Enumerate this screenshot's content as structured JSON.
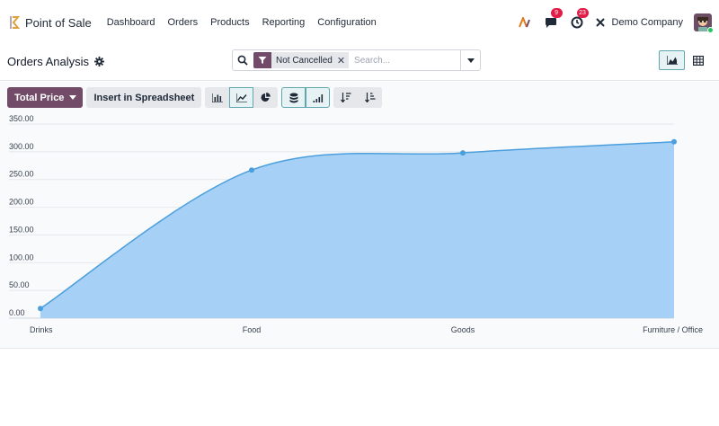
{
  "navbar": {
    "app_name": "Point of Sale",
    "menu": [
      "Dashboard",
      "Orders",
      "Products",
      "Reporting",
      "Configuration"
    ],
    "messages_count": "9",
    "activities_count": "23",
    "company_name": "Demo Company"
  },
  "control_panel": {
    "title": "Orders Analysis",
    "facet_label": "Not Cancelled",
    "search_placeholder": "Search..."
  },
  "toolbar": {
    "measure_label": "Total Price",
    "insert_label": "Insert in Spreadsheet"
  },
  "colors": {
    "brand": "#714b67",
    "accent": "#5fa6ad",
    "area_fill": "#a6d0f5",
    "line": "#4a9fdc"
  },
  "chart_data": {
    "type": "area",
    "categories": [
      "Drinks",
      "Food",
      "Goods",
      "Furniture / Office"
    ],
    "values": [
      17.5,
      267,
      298,
      318
    ],
    "y_ticks": [
      "0.00",
      "50.00",
      "100.00",
      "150.00",
      "200.00",
      "250.00",
      "300.00",
      "350.00"
    ],
    "ylim": [
      0,
      350
    ],
    "grid": true,
    "smooth": true
  }
}
